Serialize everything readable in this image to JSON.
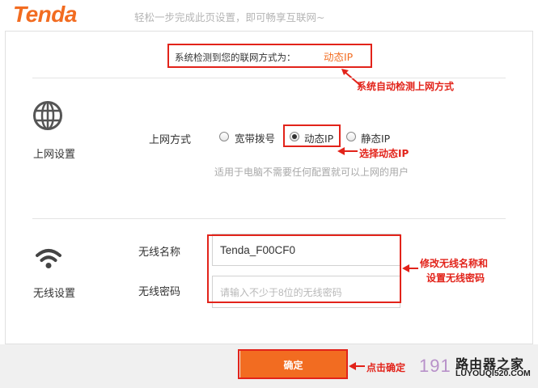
{
  "header": {
    "logo": "Tenda",
    "slogan": "轻松一步完成此页设置，即可畅享互联网~"
  },
  "detection": {
    "label": "系统检测到您的联网方式为：",
    "value": "动态IP",
    "annotation": "系统自动检测上网方式"
  },
  "internet": {
    "section_label": "上网设置",
    "field_label": "上网方式",
    "options": [
      "宽带拨号",
      "动态IP",
      "静态IP"
    ],
    "selected": "动态IP",
    "annotation": "选择动态IP",
    "hint": "适用于电脑不需要任何配置就可以上网的用户"
  },
  "wireless": {
    "section_label": "无线设置",
    "name_label": "无线名称",
    "name_value": "Tenda_F00CF0",
    "password_label": "无线密码",
    "password_placeholder": "请输入不少于8位的无线密码",
    "annotation_line1": "修改无线名称和",
    "annotation_line2": "设置无线密码"
  },
  "footer": {
    "confirm_label": "确定",
    "annotation": "点击确定"
  },
  "watermark": {
    "number": "191",
    "cn": "路由器之家",
    "en": "LUYOUQI520.COM"
  },
  "colors": {
    "brand_orange": "#f26c21",
    "annotation_red": "#e2231a"
  }
}
